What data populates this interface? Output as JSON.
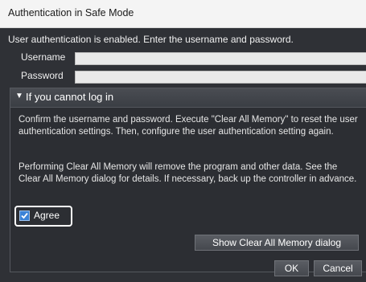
{
  "window": {
    "title": "Authentication in Safe Mode"
  },
  "intro": "User authentication is enabled. Enter the username and password.",
  "fields": {
    "username_label": "Username",
    "username_value": "",
    "password_label": "Password",
    "password_value": ""
  },
  "section": {
    "header": "If you cannot log in",
    "paragraph1": "Confirm the username and password. Execute \"Clear All Memory\" to reset the user authentication settings. Then, configure the user authentication setting again.",
    "paragraph2": "Performing Clear All Memory will remove the program and other data. See the Clear All Memory dialog for details. If necessary, back up the controller in advance.",
    "agree_label": "Agree",
    "agree_checked": true,
    "show_dialog_button": "Show Clear All Memory dialog"
  },
  "footer": {
    "ok_label": "OK",
    "cancel_label": "Cancel"
  },
  "colors": {
    "panel_bg": "#2f3136",
    "checkbox_accent": "#3b82d6"
  }
}
